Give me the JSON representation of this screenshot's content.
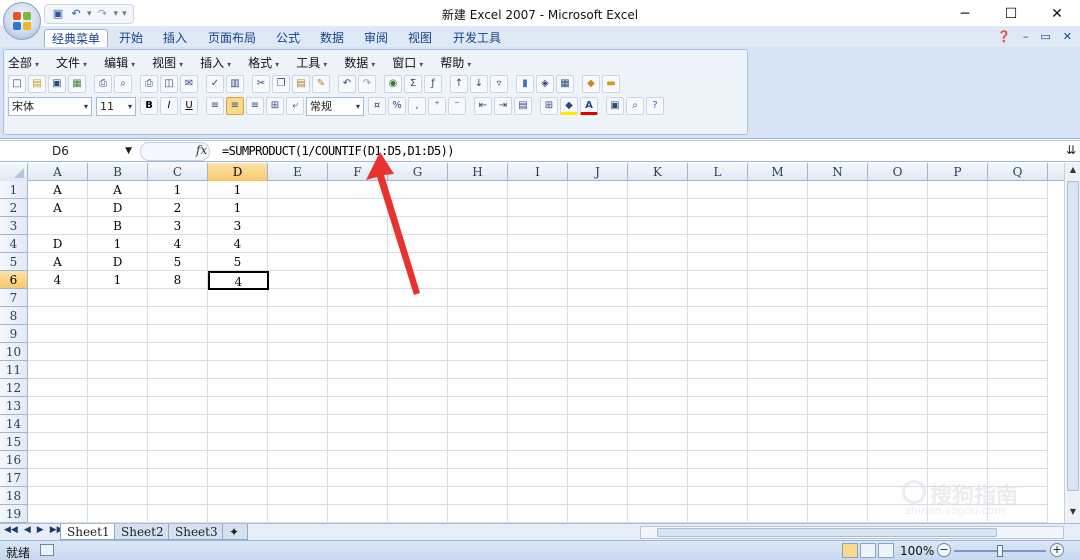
{
  "window": {
    "title": "新建 Excel 2007 - Microsoft Excel",
    "controls": {
      "minimize": "─",
      "maximize": "☐",
      "close": "✕"
    }
  },
  "qat": {
    "items": [
      "save-icon",
      "undo-icon",
      "redo-icon",
      "customize-icon"
    ]
  },
  "ribbon_tabs": {
    "items": [
      "经典菜单",
      "开始",
      "插入",
      "页面布局",
      "公式",
      "数据",
      "审阅",
      "视图",
      "开发工具"
    ],
    "active": 0,
    "right": [
      "❓",
      "–",
      "▭",
      "✕"
    ]
  },
  "menubar": {
    "items": [
      "全部",
      "文件",
      "编辑",
      "视图",
      "插入",
      "格式",
      "工具",
      "数据",
      "窗口",
      "帮助"
    ]
  },
  "toolbar": {
    "font_name": "宋体",
    "font_size": "11",
    "number_format": "常规",
    "bold": "B",
    "italic": "I",
    "underline": "U",
    "percent": "%",
    "comma": ","
  },
  "formula_bar": {
    "name_box": "D6",
    "fx": "fx",
    "formula": "=SUMPRODUCT(1/COUNTIF(D1:D5,D1:D5))"
  },
  "grid": {
    "columns": [
      "A",
      "B",
      "C",
      "D",
      "E",
      "F",
      "G",
      "H",
      "I",
      "J",
      "K",
      "L",
      "M",
      "N",
      "O",
      "P",
      "Q"
    ],
    "rows": [
      "1",
      "2",
      "3",
      "4",
      "5",
      "6",
      "7",
      "8",
      "9",
      "10",
      "11",
      "12",
      "13",
      "14",
      "15",
      "16",
      "17",
      "18",
      "19"
    ],
    "selected_col": "D",
    "selected_row": "6",
    "cells": [
      [
        "A",
        "A",
        "1",
        "1"
      ],
      [
        "A",
        "D",
        "2",
        "1"
      ],
      [
        "",
        "B",
        "3",
        "3"
      ],
      [
        "D",
        "1",
        "4",
        "4"
      ],
      [
        "A",
        "D",
        "5",
        "5"
      ],
      [
        "4",
        "1",
        "8",
        "4"
      ]
    ]
  },
  "sheets": {
    "items": [
      "Sheet1",
      "Sheet2",
      "Sheet3"
    ],
    "active": 0
  },
  "status": {
    "ready": "就绪",
    "zoom": "100%",
    "zoom_fraction": 0.5
  },
  "watermark": {
    "main": "搜狗指南",
    "sub": "zhinan.sogou.com"
  }
}
